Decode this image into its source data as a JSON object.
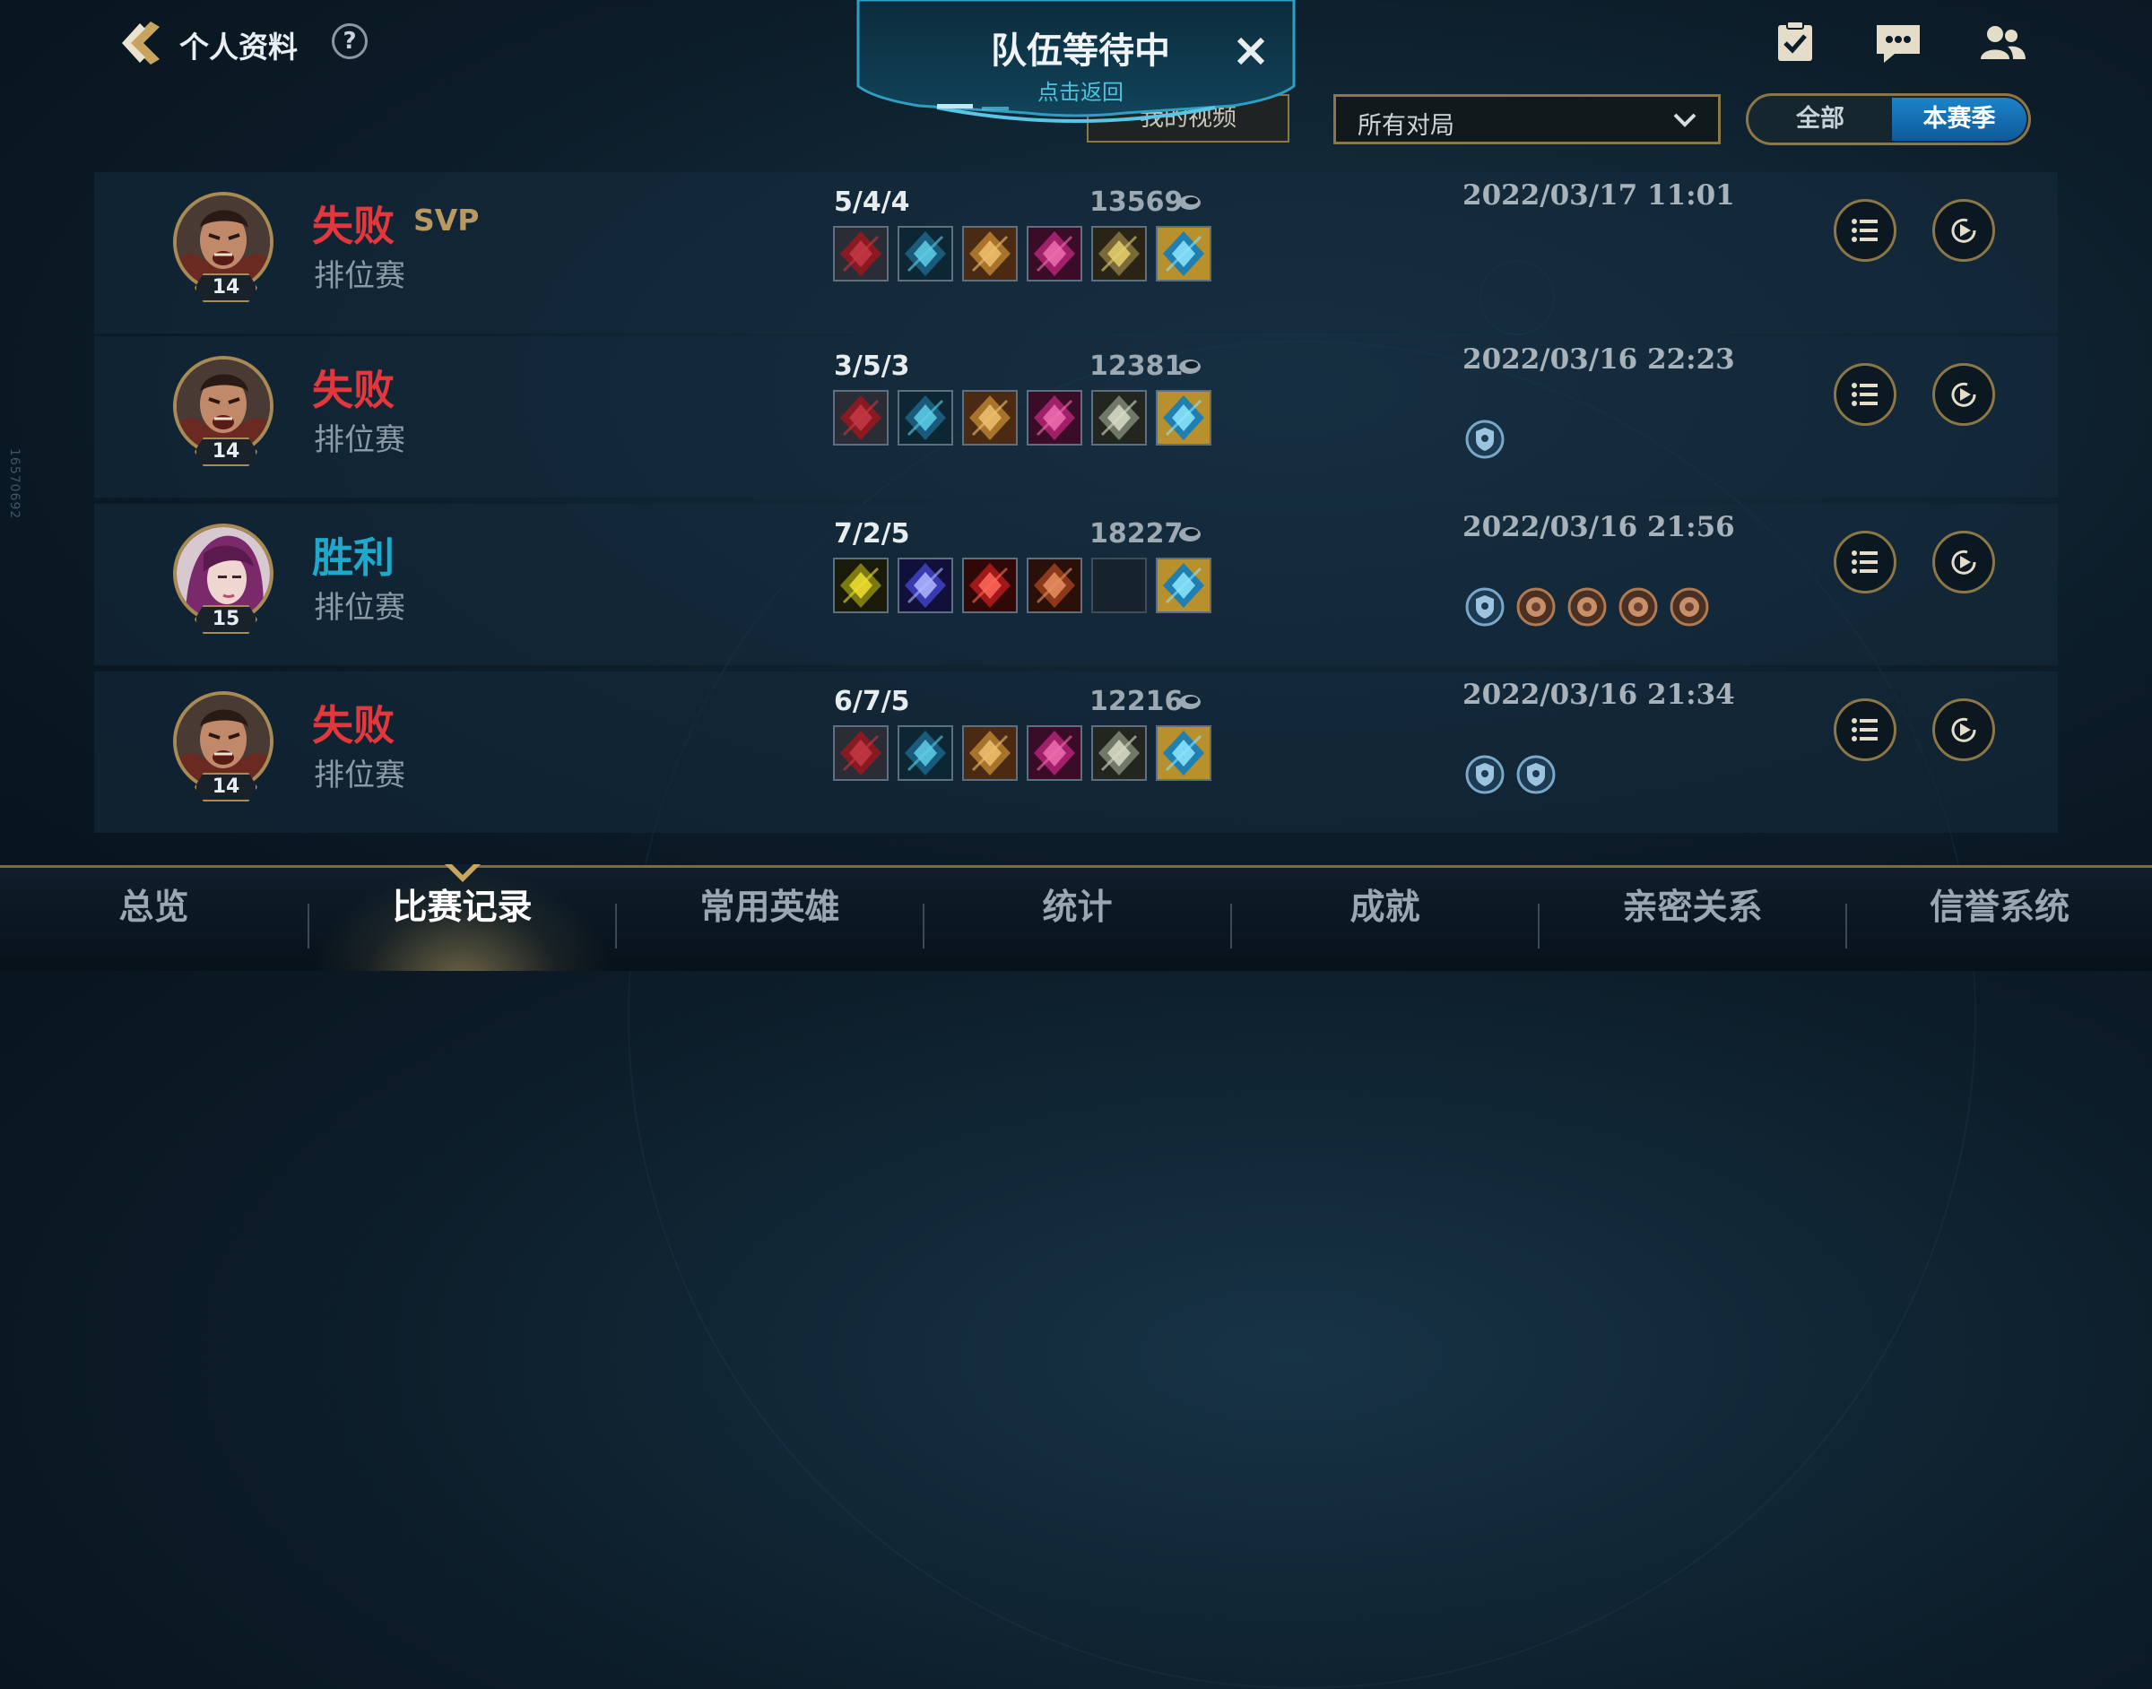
{
  "side_id": "16570692",
  "header": {
    "title": "个人资料",
    "help": "?"
  },
  "queue_banner": {
    "title": "队伍等待中",
    "subtitle": "点击返回"
  },
  "filters": {
    "my_video": "我的视频",
    "dropdown_value": "所有对局",
    "segment_all": "全部",
    "segment_season": "本赛季",
    "segment_selected": "本赛季"
  },
  "matches": [
    {
      "result": "失败",
      "outcome": "loss",
      "svp": "SVP",
      "mode": "排位赛",
      "level": "14",
      "kda": "5/4/4",
      "power": "13569",
      "datetime": "2022/03/17 11:01",
      "hero": "darius",
      "items": [
        "c1",
        "c2",
        "c3",
        "c4",
        "c5",
        "c6"
      ],
      "badges": []
    },
    {
      "result": "失败",
      "outcome": "loss",
      "svp": "",
      "mode": "排位赛",
      "level": "14",
      "kda": "3/5/3",
      "power": "12381",
      "datetime": "2022/03/16 22:23",
      "hero": "darius",
      "items": [
        "c1",
        "c2",
        "c3",
        "c4",
        "c7",
        "c6"
      ],
      "badges": [
        "blue-shield"
      ]
    },
    {
      "result": "胜利",
      "outcome": "win",
      "svp": "",
      "mode": "排位赛",
      "level": "15",
      "kda": "7/2/5",
      "power": "18227",
      "datetime": "2022/03/16 21:56",
      "hero": "fiora",
      "items": [
        "c8",
        "c9",
        "c10",
        "c11",
        "empty",
        "c6"
      ],
      "badges": [
        "blue-shield",
        "bronze-medal",
        "bronze-medal",
        "bronze-medal",
        "bronze-medal"
      ]
    },
    {
      "result": "失败",
      "outcome": "loss",
      "svp": "",
      "mode": "排位赛",
      "level": "14",
      "kda": "6/7/5",
      "power": "12216",
      "datetime": "2022/03/16 21:34",
      "hero": "darius",
      "items": [
        "c1",
        "c2",
        "c3",
        "c4",
        "c7",
        "c6"
      ],
      "badges": [
        "blue-shield",
        "blue-shield"
      ]
    }
  ],
  "nav": {
    "tabs": [
      "总览",
      "比赛记录",
      "常用英雄",
      "统计",
      "成就",
      "亲密关系",
      "信誉系统"
    ],
    "active": "比赛记录"
  },
  "colors": {
    "loss": "#e2373d",
    "win": "#1ea8cc",
    "gold_border": "#8b7748",
    "season_active": "#1c84c8"
  }
}
